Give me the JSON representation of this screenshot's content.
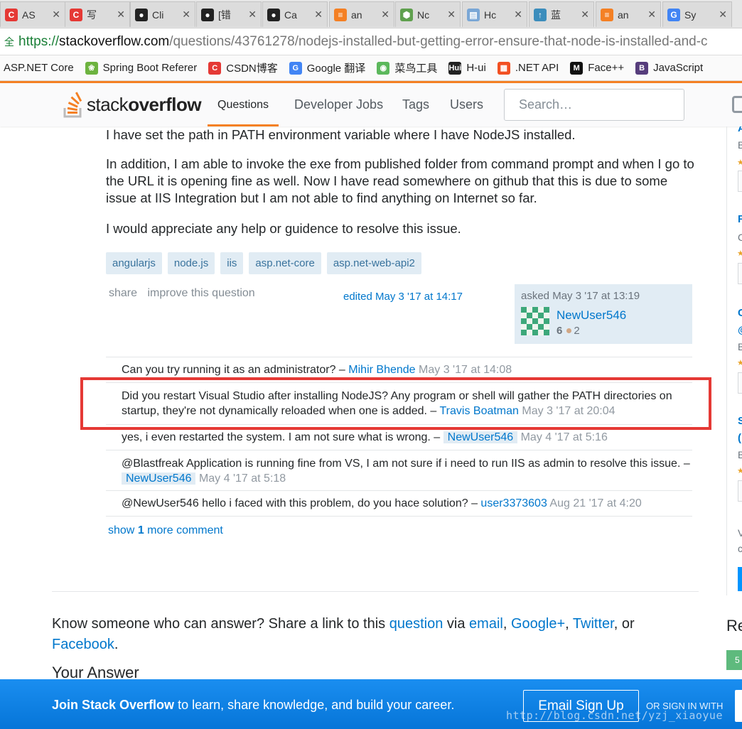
{
  "browser": {
    "tabs": [
      {
        "label": "AS",
        "icon": "csdn-icon",
        "color": "#e53935",
        "glyph": "C"
      },
      {
        "label": "写",
        "icon": "csdn-icon",
        "color": "#e53935",
        "glyph": "C"
      },
      {
        "label": "Cli",
        "icon": "github-icon",
        "color": "#222222",
        "glyph": "●"
      },
      {
        "label": "[错",
        "icon": "github-icon",
        "color": "#222222",
        "glyph": "●"
      },
      {
        "label": "Ca",
        "icon": "github-icon",
        "color": "#222222",
        "glyph": "●"
      },
      {
        "label": "an",
        "icon": "stackoverflow-icon",
        "color": "#f48024",
        "glyph": "≡"
      },
      {
        "label": "Nc",
        "icon": "nodejs-icon",
        "color": "#5fa04e",
        "glyph": "⬢"
      },
      {
        "label": "Hc",
        "icon": "document-icon",
        "color": "#7aa7d6",
        "glyph": "▤"
      },
      {
        "label": "蓝",
        "icon": "upload-icon",
        "color": "#3c8dbc",
        "glyph": "↑"
      },
      {
        "label": "an",
        "icon": "stackoverflow-icon",
        "color": "#f48024",
        "glyph": "≡"
      },
      {
        "label": "Sy",
        "icon": "google-icon",
        "color": "#4285f4",
        "glyph": "G"
      }
    ],
    "url": {
      "scheme": "https://",
      "host": "stackoverflow.com",
      "path": "/questions/43761278/nodejs-installed-but-getting-error-ensure-that-node-is-installed-and-c"
    },
    "bookmarks": [
      {
        "label": "ASP.NET Core",
        "icon": "",
        "color": ""
      },
      {
        "label": "Spring Boot Referer",
        "icon": "spring-icon",
        "color": "#6db33f",
        "glyph": "❀"
      },
      {
        "label": "CSDN博客",
        "icon": "csdn-icon",
        "color": "#e53935",
        "glyph": "C"
      },
      {
        "label": "Google 翻译",
        "icon": "translate-icon",
        "color": "#4285f4",
        "glyph": "G"
      },
      {
        "label": "菜鸟工具",
        "icon": "runoob-icon",
        "color": "#5cb85c",
        "glyph": "◉"
      },
      {
        "label": "H-ui",
        "icon": "hui-icon",
        "color": "#222222",
        "glyph": "Hui"
      },
      {
        "label": ".NET API",
        "icon": "microsoft-icon",
        "color": "#f25022",
        "glyph": "▦"
      },
      {
        "label": "Face++",
        "icon": "faceplusplus-icon",
        "color": "#111111",
        "glyph": "M"
      },
      {
        "label": "JavaScript",
        "icon": "bootstrap-icon",
        "color": "#563d7c",
        "glyph": "B"
      }
    ]
  },
  "header": {
    "logo_light": "stack",
    "logo_bold": "overflow",
    "nav": [
      "Questions",
      "Developer Jobs",
      "Tags",
      "Users"
    ],
    "search_placeholder": "Search…"
  },
  "question": {
    "paragraphs": [
      "I have set the path in PATH environment variable where I have NodeJS installed.",
      "In addition, I am able to invoke the exe from published folder from command prompt and when I go to the URL it is opening fine as well. Now I have read somewhere on github that this is due to some issue at IIS Integration but I am not able to find anything on Internet so far.",
      "I would appreciate any help or guidence to resolve this issue."
    ],
    "tags": [
      "angularjs",
      "node.js",
      "iis",
      "asp.net-core",
      "asp.net-web-api2"
    ],
    "menu": {
      "share": "share",
      "improve": "improve this question"
    },
    "edited": "edited May 3 '17 at 14:17",
    "owner": {
      "asked": "asked May 3 '17 at 13:19",
      "name": "NewUser546",
      "reputation": "6",
      "bronze": "2"
    }
  },
  "comments": [
    {
      "text": "Can you try running it as an administrator? –",
      "author": "Mihir Bhende",
      "date": "May 3 '17 at 14:08",
      "op": false
    },
    {
      "text": "Did you restart Visual Studio after installing NodeJS? Any program or shell will gather the PATH directories on startup, they're not dynamically reloaded when one is added. –",
      "author": "Travis Boatman",
      "date": "May 3 '17 at 20:04",
      "op": false
    },
    {
      "text": "yes, i even restarted the system. I am not sure what is wrong. –",
      "author": "NewUser546",
      "date": "May 4 '17 at 5:16",
      "op": true
    },
    {
      "text": "@Blastfreak Application is running fine from VS, I am not sure if i need to run IIS as admin to resolve this issue. –",
      "author": "NewUser546",
      "date": "May 4 '17 at 5:18",
      "op": true
    },
    {
      "text": "@NewUser546 hello i faced with this problem, do you hace solution? –",
      "author": "user3373603",
      "date": "Aug 21 '17 at 4:20",
      "op": false
    }
  ],
  "show_more": {
    "prefix": "show",
    "count": "1",
    "suffix": "more comment"
  },
  "share_text": {
    "part1": "Know someone who can answer? Share a link to this",
    "question": "question",
    "via": "via",
    "email": "email",
    "google": "Google+",
    "twitter": "Twitter",
    "or": "or",
    "facebook": "Facebook"
  },
  "your_answer": "Your Answer",
  "sidebar": {
    "re": "Re",
    "green_count": "5"
  },
  "signup": {
    "bold": "Join Stack Overflow",
    "rest": "to learn, share knowledge, and build your career.",
    "button": "Email Sign Up",
    "or": "OR SIGN IN WITH"
  },
  "watermark": "http://blog.csdn.net/yzj_xiaoyue",
  "colors": {
    "accent": "#f48024",
    "link": "#0077cc",
    "highlight": "#e53935",
    "signup": "#0a82e6"
  }
}
